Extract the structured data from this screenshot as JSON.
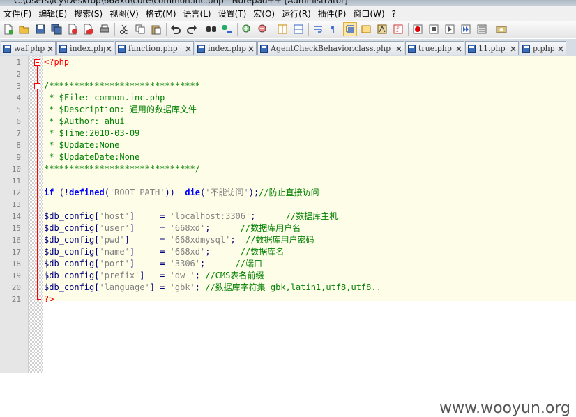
{
  "window": {
    "title": "C:\\Users\\icy\\Desktop\\668xd\\core\\common.inc.php - Notepad++ [Administrator]"
  },
  "menu": [
    "文件(F)",
    "编辑(E)",
    "搜索(S)",
    "视图(V)",
    "格式(M)",
    "语言(L)",
    "设置(T)",
    "宏(O)",
    "运行(R)",
    "插件(P)",
    "窗口(W)",
    "?"
  ],
  "toolbar": {
    "buttons": [
      "new-file-icon",
      "open-file-icon",
      "save-icon",
      "save-all-icon",
      "close-icon",
      "close-all-icon",
      "print-icon",
      "|",
      "cut-icon",
      "copy-icon",
      "paste-icon",
      "|",
      "undo-icon",
      "redo-icon",
      "|",
      "find-icon",
      "replace-icon",
      "|",
      "zoom-in-icon",
      "zoom-out-icon",
      "|",
      "sync-vertical-icon",
      "sync-horizontal-icon",
      "|",
      "word-wrap-icon",
      "show-all-chars-icon",
      "indent-guide-icon",
      "user-lang-icon",
      "doc-map-icon",
      "function-list-icon",
      "|",
      "record-macro-icon",
      "stop-record-icon",
      "play-macro-icon",
      "run-macro-multiple-icon",
      "save-macro-icon",
      "|",
      "launch-browser-icon"
    ],
    "active": "indent-guide-icon"
  },
  "tabs": [
    {
      "label": "waf.php",
      "active": false
    },
    {
      "label": "index.php",
      "active": false
    },
    {
      "label": "function.php",
      "active": false
    },
    {
      "label": "index.php",
      "active": false
    },
    {
      "label": "AgentCheckBehavior.class.php",
      "active": false
    },
    {
      "label": "true.php",
      "active": false
    },
    {
      "label": "11.php",
      "active": false
    },
    {
      "label": "p.php",
      "active": false
    }
  ],
  "editor": {
    "lines": [
      [
        [
          "tag",
          "<?php"
        ]
      ],
      [],
      [
        [
          "cmt",
          "/******************************"
        ]
      ],
      [
        [
          "cmt",
          " * $File: common.inc.php"
        ]
      ],
      [
        [
          "cmt",
          " * $Description: 通用的数据库文件"
        ]
      ],
      [
        [
          "cmt",
          " * $Author: ahui"
        ]
      ],
      [
        [
          "cmt",
          " * $Time:2010-03-09"
        ]
      ],
      [
        [
          "cmt",
          " * $Update:None"
        ]
      ],
      [
        [
          "cmt",
          " * $UpdateDate:None"
        ]
      ],
      [
        [
          "cmt",
          "******************************/"
        ]
      ],
      [],
      [
        [
          "kw",
          "if"
        ],
        [
          "op",
          " (!"
        ],
        [
          "kw",
          "defined"
        ],
        [
          "op",
          "("
        ],
        [
          "str",
          "'ROOT_PATH'"
        ],
        [
          "op",
          "))  "
        ],
        [
          "kw",
          "die"
        ],
        [
          "op",
          "("
        ],
        [
          "str",
          "'不能访问'"
        ],
        [
          "op",
          ");"
        ],
        [
          "cmt",
          "//防止直接访问"
        ]
      ],
      [],
      [
        [
          "var",
          "$db_config"
        ],
        [
          "op",
          "["
        ],
        [
          "str",
          "'host'"
        ],
        [
          "op",
          "]     = "
        ],
        [
          "str",
          "'localhost:3306'"
        ],
        [
          "op",
          ";      "
        ],
        [
          "cmt",
          "//数据库主机"
        ]
      ],
      [
        [
          "var",
          "$db_config"
        ],
        [
          "op",
          "["
        ],
        [
          "str",
          "'user'"
        ],
        [
          "op",
          "]     = "
        ],
        [
          "str",
          "'668xd'"
        ],
        [
          "op",
          ";      "
        ],
        [
          "cmt",
          "//数据库用户名"
        ]
      ],
      [
        [
          "var",
          "$db_config"
        ],
        [
          "op",
          "["
        ],
        [
          "str",
          "'pwd'"
        ],
        [
          "op",
          "]      = "
        ],
        [
          "str",
          "'668xdmysql'"
        ],
        [
          "op",
          ";  "
        ],
        [
          "cmt",
          "//数据库用户密码"
        ]
      ],
      [
        [
          "var",
          "$db_config"
        ],
        [
          "op",
          "["
        ],
        [
          "str",
          "'name'"
        ],
        [
          "op",
          "]     = "
        ],
        [
          "str",
          "'668xd'"
        ],
        [
          "op",
          ";      "
        ],
        [
          "cmt",
          "//数据库名"
        ]
      ],
      [
        [
          "var",
          "$db_config"
        ],
        [
          "op",
          "["
        ],
        [
          "str",
          "'port'"
        ],
        [
          "op",
          "]     = "
        ],
        [
          "str",
          "'3306'"
        ],
        [
          "op",
          ";      "
        ],
        [
          "cmt",
          "//端口"
        ]
      ],
      [
        [
          "var",
          "$db_config"
        ],
        [
          "op",
          "["
        ],
        [
          "str",
          "'prefix'"
        ],
        [
          "op",
          "]   = "
        ],
        [
          "str",
          "'dw_'"
        ],
        [
          "op",
          "; "
        ],
        [
          "cmt",
          "//CMS表名前缀"
        ]
      ],
      [
        [
          "var",
          "$db_config"
        ],
        [
          "op",
          "["
        ],
        [
          "str",
          "'language'"
        ],
        [
          "op",
          "] = "
        ],
        [
          "str",
          "'gbk'"
        ],
        [
          "op",
          "; "
        ],
        [
          "cmt",
          "//数据库字符集 gbk,latin1,utf8,utf8.."
        ]
      ],
      [
        [
          "tag",
          "?>"
        ]
      ]
    ]
  },
  "watermark": "www.wooyun.org"
}
